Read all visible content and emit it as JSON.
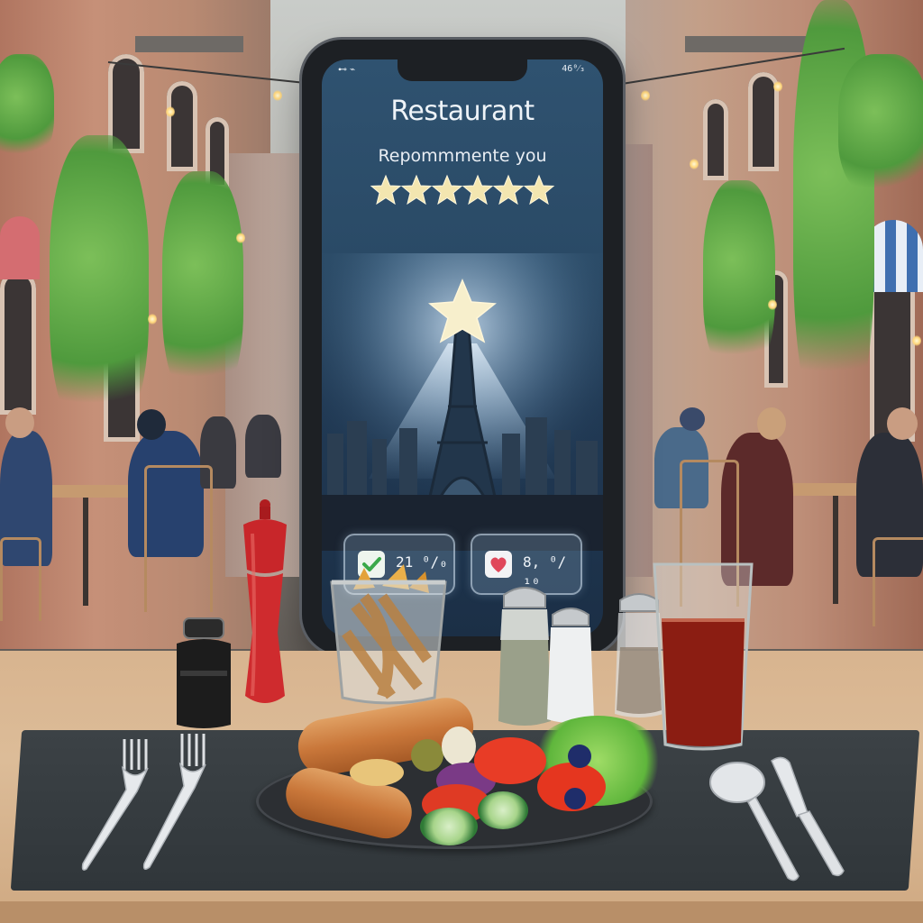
{
  "phone": {
    "status_left": "⊷ ⌁",
    "status_right": "46⁰⁄₃",
    "title": "Restaurant",
    "subtitle": "Repommmente you",
    "rating_stars": 6,
    "check_value": "21 ⁰/₀",
    "heart_value": "8, ⁰/₁₀"
  },
  "icons": {
    "check": "check-icon",
    "heart": "heart-icon",
    "star": "star-icon"
  },
  "colors": {
    "screen": "#2a4a66",
    "star": "#f3e6b0",
    "check": "#3aa84a",
    "heart": "#e0475a",
    "pepper_mill": "#c8262a"
  }
}
